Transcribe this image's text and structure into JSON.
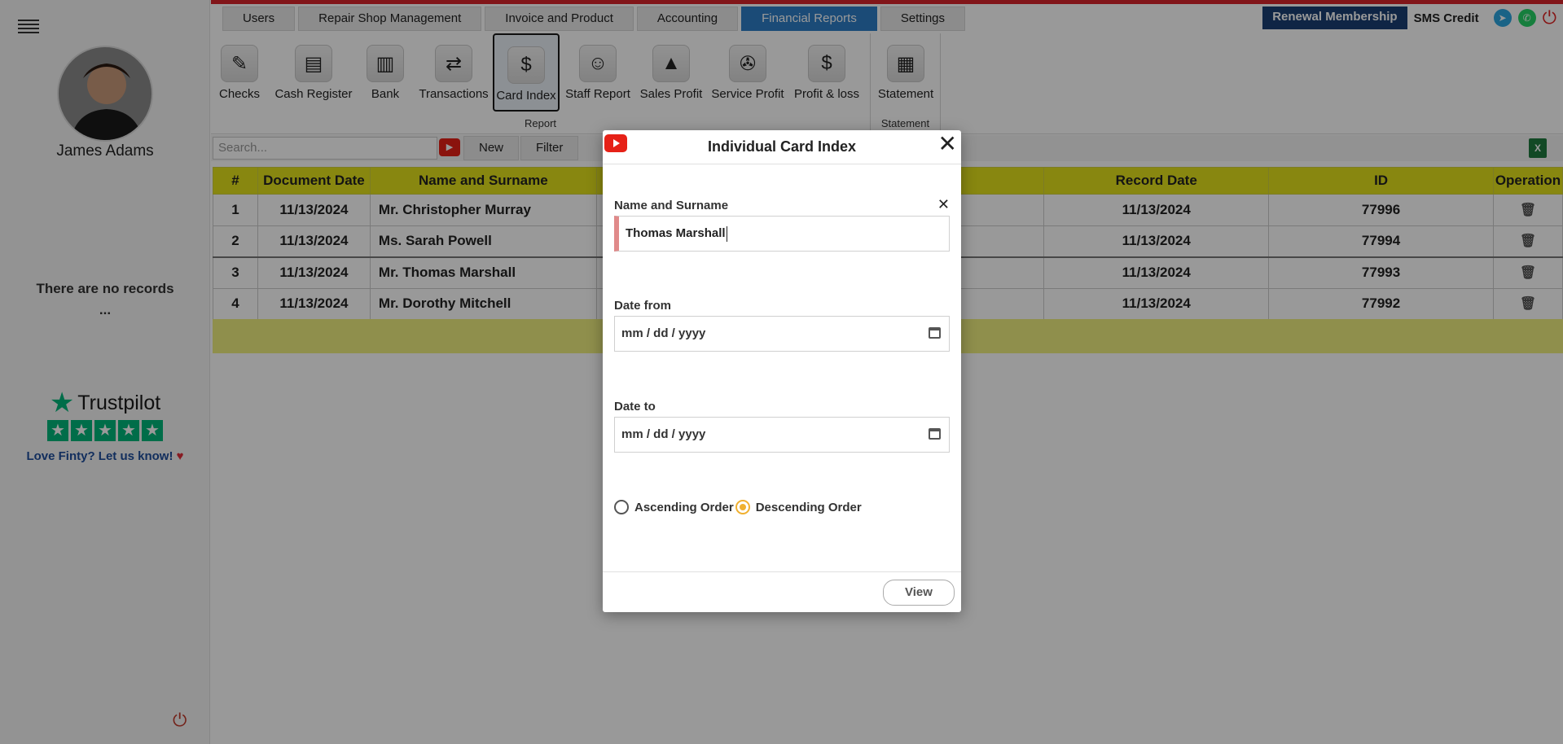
{
  "sidebar": {
    "user_name": "James Adams",
    "no_records_line1": "There are no records",
    "no_records_line2": "...",
    "trustpilot_brand": "Trustpilot",
    "trustpilot_cta": "Love Finty? Let us know!"
  },
  "nav": {
    "tabs": [
      {
        "label": "Users"
      },
      {
        "label": "Repair Shop Management"
      },
      {
        "label": "Invoice and Product"
      },
      {
        "label": "Accounting"
      },
      {
        "label": "Financial Reports",
        "active": true
      },
      {
        "label": "Settings"
      }
    ],
    "renewal_label": "Renewal Membership",
    "sms_label": "SMS Credit"
  },
  "ribbon": {
    "report_items": [
      {
        "label": "Checks",
        "icon": "checks-icon"
      },
      {
        "label": "Cash Register",
        "icon": "cash-register-icon"
      },
      {
        "label": "Bank",
        "icon": "bank-icon"
      },
      {
        "label": "Transactions",
        "icon": "transactions-icon"
      },
      {
        "label": "Card Index",
        "icon": "card-index-icon",
        "selected": true
      },
      {
        "label": "Staff Report",
        "icon": "staff-report-icon"
      },
      {
        "label": "Sales Profit",
        "icon": "sales-profit-icon"
      },
      {
        "label": "Service Profit",
        "icon": "service-profit-icon"
      },
      {
        "label": "Profit & loss",
        "icon": "profit-loss-icon"
      }
    ],
    "report_group_label": "Report",
    "statement_item": {
      "label": "Statement",
      "icon": "statement-icon"
    },
    "statement_group_label": "Statement"
  },
  "toolbar": {
    "search_placeholder": "Search...",
    "new_label": "New",
    "filter_label": "Filter"
  },
  "table": {
    "headers": {
      "num": "#",
      "doc_date": "Document Date",
      "name": "Name and Surname",
      "record_date": "Record Date",
      "id": "ID",
      "operation": "Operation"
    },
    "rows": [
      {
        "num": "1",
        "doc_date": "11/13/2024",
        "name": "Mr. Christopher Murray",
        "record_date": "11/13/2024",
        "id": "77996"
      },
      {
        "num": "2",
        "doc_date": "11/13/2024",
        "name": "Ms. Sarah Powell",
        "record_date": "11/13/2024",
        "id": "77994"
      },
      {
        "num": "3",
        "doc_date": "11/13/2024",
        "name": "Mr. Thomas Marshall",
        "record_date": "11/13/2024",
        "id": "77993"
      },
      {
        "num": "4",
        "doc_date": "11/13/2024",
        "name": "Mr. Dorothy Mitchell",
        "record_date": "11/13/2024",
        "id": "77992"
      }
    ]
  },
  "modal": {
    "title": "Individual Card Index",
    "name_label": "Name and Surname",
    "name_value": "Thomas Marshall",
    "date_from_label": "Date from",
    "date_from_placeholder": "mm / dd / yyyy",
    "date_to_label": "Date to",
    "date_to_placeholder": "mm / dd / yyyy",
    "ascending_label": "Ascending Order",
    "descending_label": "Descending Order",
    "sort_order_selected": "Descending Order",
    "view_label": "View"
  },
  "colors": {
    "accent_blue": "#2d7ec7",
    "renewal_navy": "#1a3f73",
    "table_header_yellow": "#e3e21c",
    "trustpilot_green": "#00b67a",
    "top_red": "#d8232a",
    "radio_selected": "#f0b030"
  }
}
